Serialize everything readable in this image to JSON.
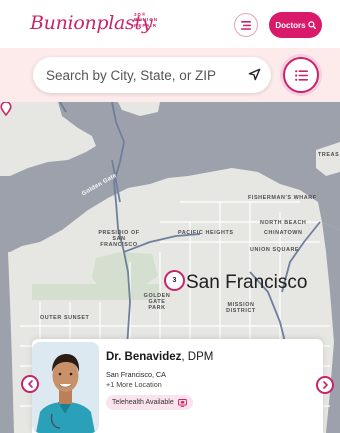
{
  "header": {
    "logo_text": "Bunionplasty",
    "logo_sub": [
      "3D®",
      "BUNION",
      "REPAIR"
    ],
    "doctors_label": "Doctors"
  },
  "search": {
    "placeholder": "Search by City, State, or ZIP"
  },
  "map": {
    "city_label": "San Francisco",
    "water_labels": [
      "Golden Gate"
    ],
    "neighborhoods": [
      "FISHERMAN'S WHARF",
      "NORTH BEACH",
      "PACIFIC HEIGHTS",
      "CHINATOWN",
      "PRESIDIO OF SAN FRANCISCO",
      "UNION SQUARE",
      "GOLDEN GATE PARK",
      "MISSION DISTRICT",
      "OUTER SUNSET",
      "TREAS"
    ],
    "cluster_count": "3"
  },
  "card": {
    "name": "Dr. Benavidez",
    "credential": ", DPM",
    "city": "San Francisco, CA",
    "more_locations": "+1 More Location",
    "telehealth": "Telehealth Available"
  },
  "colors": {
    "brand": "#c8246a",
    "button": "#d9196a",
    "band": "#fcebea",
    "land": "#e6e6e3",
    "water": "#9ca1ab",
    "park": "#d4dfcf"
  }
}
